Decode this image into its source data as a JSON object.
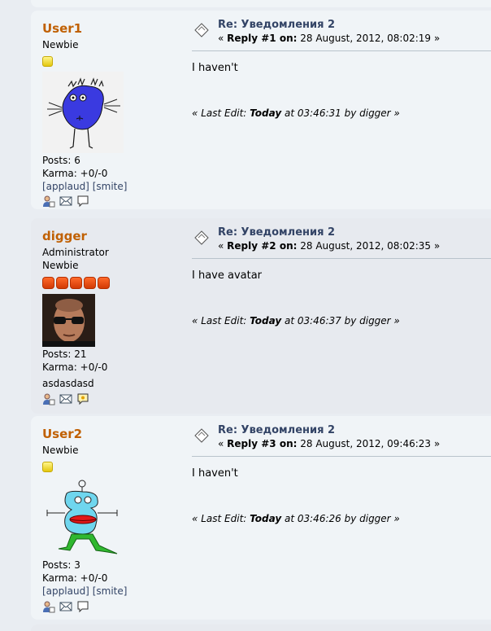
{
  "posts": [
    {
      "name": "User1",
      "rank": "Newbie",
      "group": "",
      "star_type": "yellow",
      "star_count": 1,
      "avatar": "blue-monster-drawing",
      "posts_label": "Posts: 6",
      "karma_label": "Karma: +0/-0",
      "karma_links": "[applaud] [smite]",
      "applaud_label": "[applaud]",
      "smite_label": "[smite]",
      "signature": "",
      "subject": "Re: Уведомления 2",
      "reply_prefix": "«",
      "reply_num": "Reply #1 on:",
      "reply_date": "28 August, 2012, 08:02:19 »",
      "body": "I haven't",
      "last_edit_prefix": "« Last Edit:",
      "last_edit_day": "Today",
      "last_edit_rest": "at 03:46:31 by digger »"
    },
    {
      "name": "digger",
      "rank": "Administrator",
      "group": "Newbie",
      "star_type": "red",
      "star_count": 5,
      "avatar": "man-with-sunglasses-photo",
      "posts_label": "Posts: 21",
      "karma_label": "Karma: +0/-0",
      "karma_links": "",
      "signature": "asdasdasd",
      "subject": "Re: Уведомления 2",
      "reply_prefix": "«",
      "reply_num": "Reply #2 on:",
      "reply_date": "28 August, 2012, 08:02:35 »",
      "body": "I have avatar",
      "last_edit_prefix": "« Last Edit:",
      "last_edit_day": "Today",
      "last_edit_rest": "at 03:46:37 by digger »"
    },
    {
      "name": "User2",
      "rank": "Newbie",
      "group": "",
      "star_type": "yellow",
      "star_count": 1,
      "avatar": "cyan-robot-drawing",
      "posts_label": "Posts: 3",
      "karma_label": "Karma: +0/-0",
      "applaud_label": "[applaud]",
      "smite_label": "[smite]",
      "signature": "",
      "subject": "Re: Уведомления 2",
      "reply_prefix": "«",
      "reply_num": "Reply #3 on:",
      "reply_date": "28 August, 2012, 09:46:23 »",
      "body": "I haven't",
      "last_edit_prefix": "« Last Edit:",
      "last_edit_day": "Today",
      "last_edit_rest": "at 03:46:26 by digger »"
    }
  ],
  "icons": [
    "profile-icon",
    "email-icon",
    "personal-message-icon"
  ],
  "colors": {
    "username": "#c06002",
    "subject": "#334466",
    "window1": "#f0f4f7",
    "window2": "#e7eaef"
  }
}
